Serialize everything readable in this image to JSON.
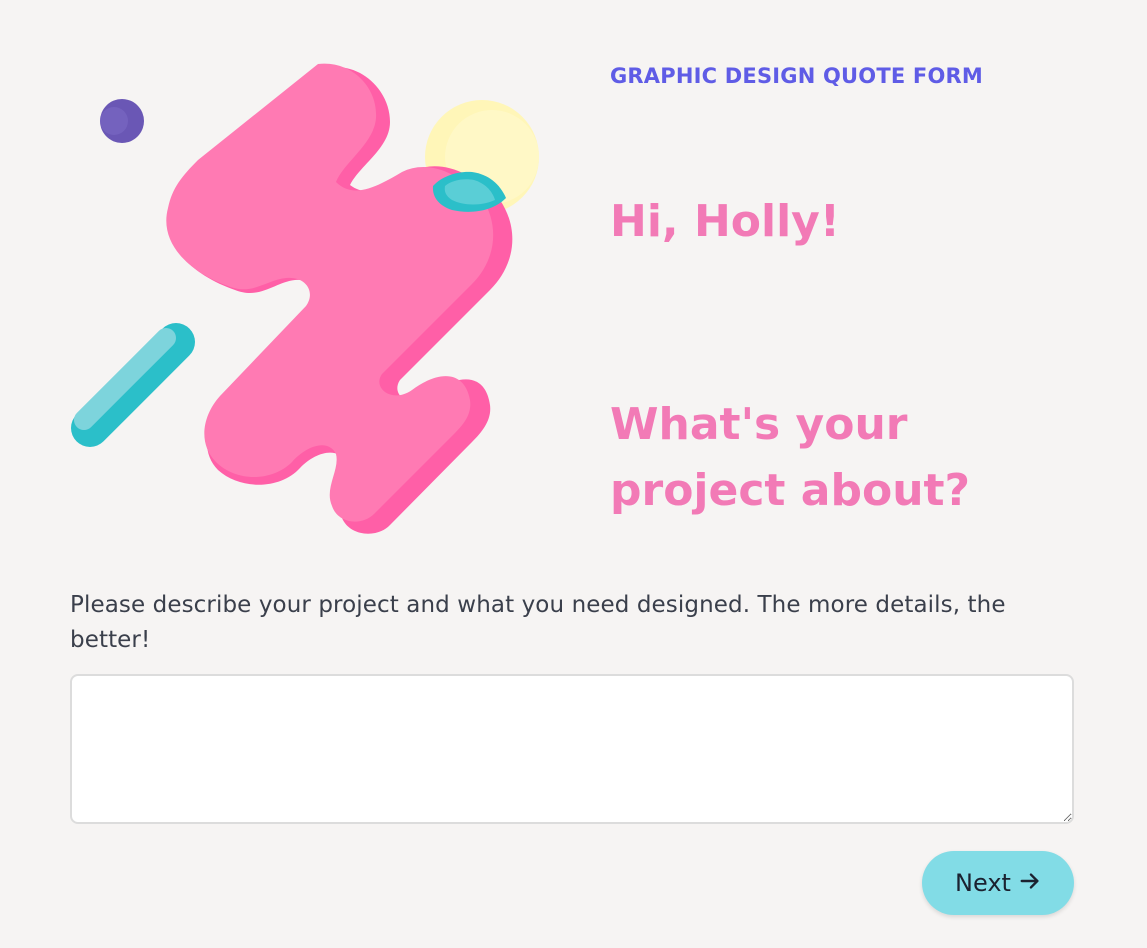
{
  "header": {
    "form_tag": "GRAPHIC DESIGN QUOTE FORM",
    "greeting": "Hi, Holly!",
    "question": "What's your project about?"
  },
  "form": {
    "description": "Please describe your project and what you need designed. The more details, the better!",
    "project_value": "",
    "project_placeholder": "",
    "next_label": "Next",
    "next_icon": "arrow-right-icon"
  },
  "theme": {
    "background": "#f6f4f3",
    "accent_purple": "#5f5ce6",
    "accent_pink": "#f27ab6",
    "button_teal": "#82dce6",
    "text_dark": "#3a3f4b"
  },
  "illustration": {
    "icon": "abstract-shapes-illustration"
  }
}
